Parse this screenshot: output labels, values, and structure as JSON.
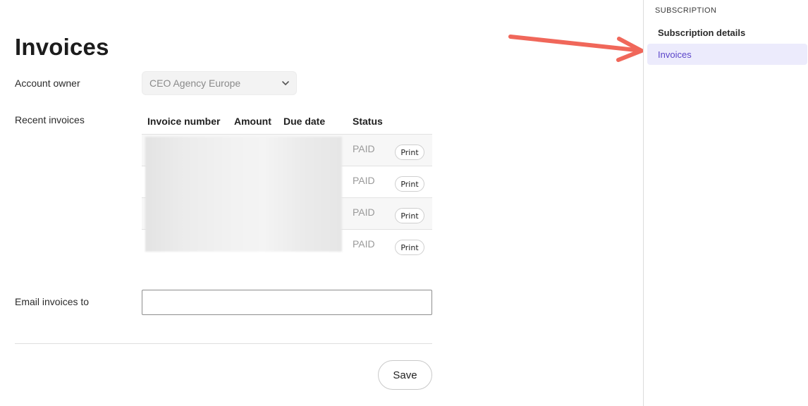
{
  "page": {
    "title": "Invoices"
  },
  "form": {
    "account_owner_label": "Account owner",
    "account_owner_value": "CEO Agency Europe",
    "recent_invoices_label": "Recent invoices",
    "email_label": "Email invoices to",
    "email_value": "",
    "email_placeholder": "",
    "save_label": "Save"
  },
  "invoices_table": {
    "columns": [
      "Invoice number",
      "Amount",
      "Due date",
      "Status"
    ],
    "rows": [
      {
        "status": "PAID",
        "action": "Print"
      },
      {
        "status": "PAID",
        "action": "Print"
      },
      {
        "status": "PAID",
        "action": "Print"
      },
      {
        "status": "PAID",
        "action": "Print"
      }
    ]
  },
  "sidebar": {
    "section_title": "SUBSCRIPTION",
    "items": [
      {
        "label": "Subscription details",
        "active": false
      },
      {
        "label": "Invoices",
        "active": true
      }
    ]
  },
  "colors": {
    "accent": "#5b45c9",
    "accent_bg": "#ecebfc",
    "annotation_arrow": "#f0675a"
  },
  "icons": {
    "select_chevron": "chevron-down-icon",
    "annotation": "arrow-icon"
  }
}
